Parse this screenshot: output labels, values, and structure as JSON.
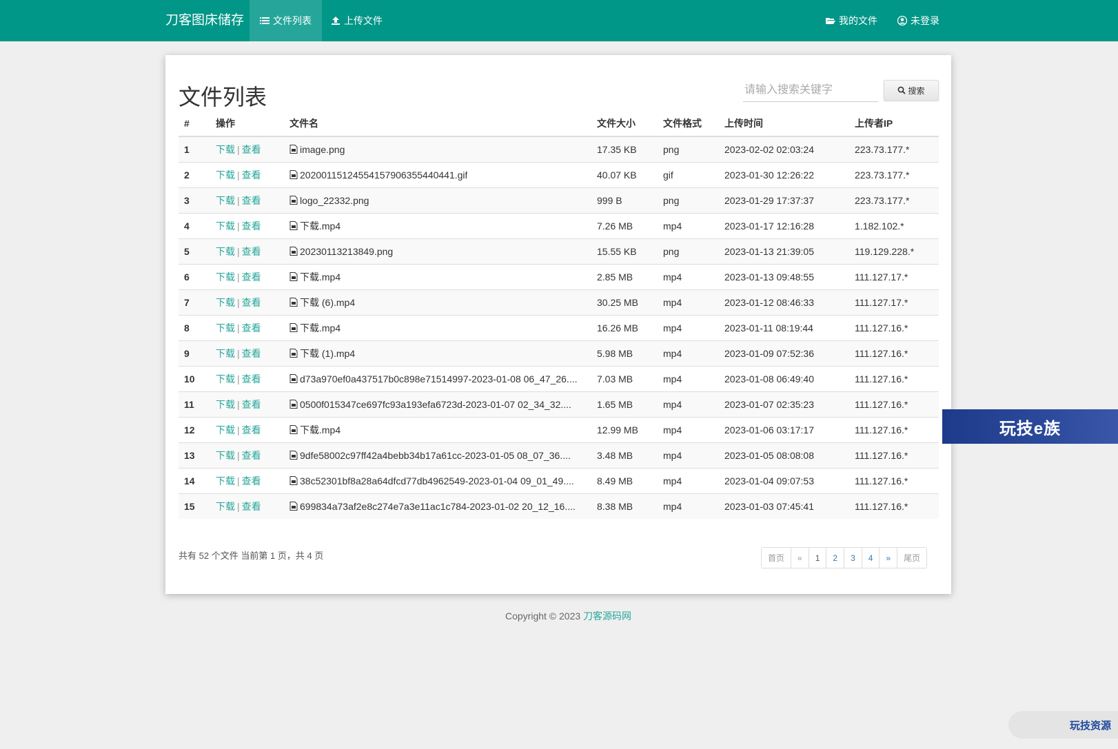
{
  "navbar": {
    "brand": "刀客图床储存",
    "nav_file_list": "文件列表",
    "nav_upload": "上传文件",
    "nav_my_files": "我的文件",
    "nav_login": "未登录"
  },
  "main": {
    "title": "文件列表",
    "search_placeholder": "请输入搜索关键字",
    "search_button": "搜索"
  },
  "table": {
    "headers": [
      "#",
      "操作",
      "文件名",
      "文件大小",
      "文件格式",
      "上传时间",
      "上传者IP"
    ],
    "download_label": "下载",
    "separator": "|",
    "view_label": "查看",
    "rows": [
      {
        "num": "1",
        "name": "image.png",
        "size": "17.35 KB",
        "format": "png",
        "time": "2023-02-02 02:03:24",
        "ip": "223.73.177.*"
      },
      {
        "num": "2",
        "name": "20200115124554157906355440441.gif",
        "size": "40.07 KB",
        "format": "gif",
        "time": "2023-01-30 12:26:22",
        "ip": "223.73.177.*"
      },
      {
        "num": "3",
        "name": "logo_22332.png",
        "size": "999 B",
        "format": "png",
        "time": "2023-01-29 17:37:37",
        "ip": "223.73.177.*"
      },
      {
        "num": "4",
        "name": "下载.mp4",
        "size": "7.26 MB",
        "format": "mp4",
        "time": "2023-01-17 12:16:28",
        "ip": "1.182.102.*"
      },
      {
        "num": "5",
        "name": "20230113213849.png",
        "size": "15.55 KB",
        "format": "png",
        "time": "2023-01-13 21:39:05",
        "ip": "119.129.228.*"
      },
      {
        "num": "6",
        "name": "下载.mp4",
        "size": "2.85 MB",
        "format": "mp4",
        "time": "2023-01-13 09:48:55",
        "ip": "111.127.17.*"
      },
      {
        "num": "7",
        "name": "下载 (6).mp4",
        "size": "30.25 MB",
        "format": "mp4",
        "time": "2023-01-12 08:46:33",
        "ip": "111.127.17.*"
      },
      {
        "num": "8",
        "name": "下载.mp4",
        "size": "16.26 MB",
        "format": "mp4",
        "time": "2023-01-11 08:19:44",
        "ip": "111.127.16.*"
      },
      {
        "num": "9",
        "name": "下载 (1).mp4",
        "size": "5.98 MB",
        "format": "mp4",
        "time": "2023-01-09 07:52:36",
        "ip": "111.127.16.*"
      },
      {
        "num": "10",
        "name": "d73a970ef0a437517b0c898e71514997-2023-01-08 06_47_26....",
        "size": "7.03 MB",
        "format": "mp4",
        "time": "2023-01-08 06:49:40",
        "ip": "111.127.16.*"
      },
      {
        "num": "11",
        "name": "0500f015347ce697fc93a193efa6723d-2023-01-07 02_34_32....",
        "size": "1.65 MB",
        "format": "mp4",
        "time": "2023-01-07 02:35:23",
        "ip": "111.127.16.*"
      },
      {
        "num": "12",
        "name": "下载.mp4",
        "size": "12.99 MB",
        "format": "mp4",
        "time": "2023-01-06 03:17:17",
        "ip": "111.127.16.*"
      },
      {
        "num": "13",
        "name": "9dfe58002c97ff42a4bebb34b17a61cc-2023-01-05 08_07_36....",
        "size": "3.48 MB",
        "format": "mp4",
        "time": "2023-01-05 08:08:08",
        "ip": "111.127.16.*"
      },
      {
        "num": "14",
        "name": "38c52301bf8a28a64dfcd77db4962549-2023-01-04 09_01_49....",
        "size": "8.49 MB",
        "format": "mp4",
        "time": "2023-01-04 09:07:53",
        "ip": "111.127.16.*"
      },
      {
        "num": "15",
        "name": "699834a73af2e8c274e7a3e11ac1c784-2023-01-02 20_12_16....",
        "size": "8.38 MB",
        "format": "mp4",
        "time": "2023-01-03 07:45:41",
        "ip": "111.127.16.*"
      }
    ]
  },
  "summary": {
    "prefix": "共有",
    "total": "52",
    "mid1": "个文件  当前第",
    "current": "1",
    "mid2": "页，共",
    "pages": "4",
    "suffix": "页"
  },
  "pagination": {
    "first": "首页",
    "prev": "«",
    "pages": [
      "1",
      "2",
      "3",
      "4"
    ],
    "next": "»",
    "last": "尾页"
  },
  "footer": {
    "copyright": "Copyright © 2023",
    "site_link": "刀客源码网"
  },
  "watermarks": {
    "banner": "玩技e族",
    "corner": "玩技资源"
  },
  "colors": {
    "primary": "#009688",
    "link": "#26a69a",
    "format": "#2222cc"
  }
}
